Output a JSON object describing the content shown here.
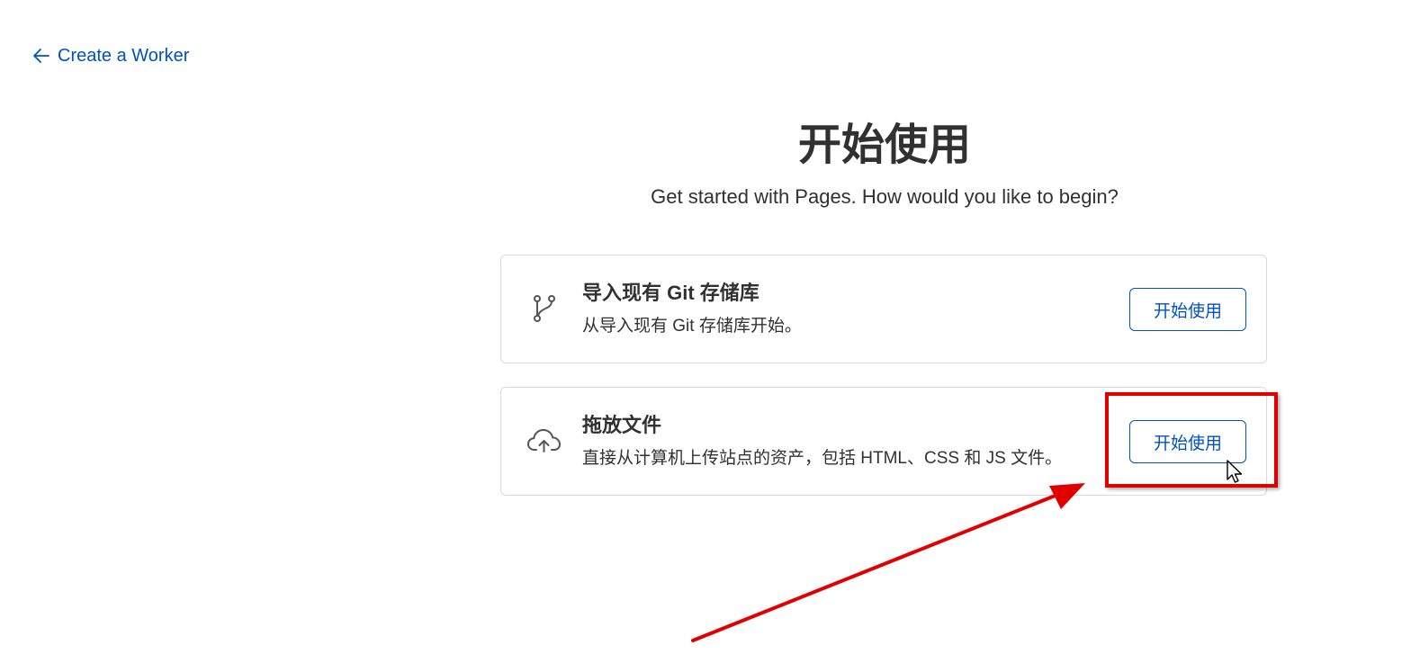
{
  "nav": {
    "back_label": "Create a Worker"
  },
  "header": {
    "title": "开始使用",
    "subtitle": "Get started with Pages. How would you like to begin?"
  },
  "options": [
    {
      "icon": "git-branch-icon",
      "title": "导入现有 Git 存储库",
      "description": "从导入现有 Git 存储库开始。",
      "button_label": "开始使用"
    },
    {
      "icon": "cloud-upload-icon",
      "title": "拖放文件",
      "description": "直接从计算机上传站点的资产，包括 HTML、CSS 和 JS 文件。",
      "button_label": "开始使用"
    }
  ],
  "colors": {
    "accent": "#0051c3",
    "text": "#313131",
    "border": "#d9d9d9",
    "annotation": "#e00000"
  }
}
